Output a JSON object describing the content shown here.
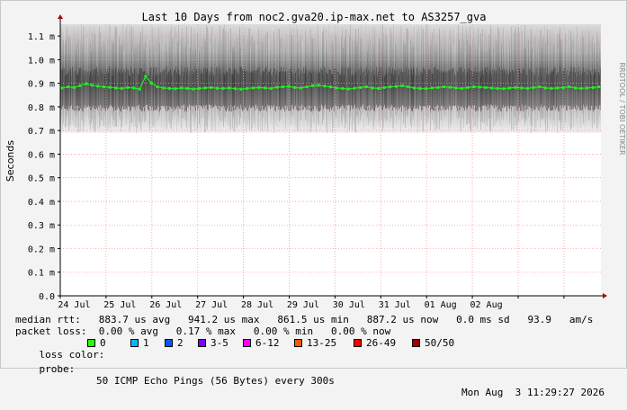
{
  "chart_data": {
    "type": "line",
    "title": "Last 10 Days from noc2.gva20.ip-max.net to AS3257_gva",
    "ylabel": "Seconds",
    "xlabel": "",
    "ylim": [
      0,
      1.15
    ],
    "y_ticks": [
      {
        "v": 0,
        "label": "0.0"
      },
      {
        "v": 0.1,
        "label": "0.1 m"
      },
      {
        "v": 0.2,
        "label": "0.2 m"
      },
      {
        "v": 0.3,
        "label": "0.3 m"
      },
      {
        "v": 0.4,
        "label": "0.4 m"
      },
      {
        "v": 0.5,
        "label": "0.5 m"
      },
      {
        "v": 0.6,
        "label": "0.6 m"
      },
      {
        "v": 0.7,
        "label": "0.7 m"
      },
      {
        "v": 0.8,
        "label": "0.8 m"
      },
      {
        "v": 0.9,
        "label": "0.9 m"
      },
      {
        "v": 1.0,
        "label": "1.0 m"
      },
      {
        "v": 1.1,
        "label": "1.1 m"
      }
    ],
    "x_ticks": [
      "24 Jul",
      "25 Jul",
      "26 Jul",
      "27 Jul",
      "28 Jul",
      "29 Jul",
      "30 Jul",
      "31 Jul",
      "01 Aug",
      "02 Aug"
    ],
    "grid": true,
    "series": [
      {
        "name": "median rtt",
        "color": "#22ee22",
        "values": [
          0.88,
          0.885,
          0.882,
          0.89,
          0.898,
          0.892,
          0.888,
          0.885,
          0.883,
          0.88,
          0.878,
          0.882,
          0.88,
          0.875,
          0.93,
          0.9,
          0.885,
          0.88,
          0.878,
          0.877,
          0.88,
          0.878,
          0.876,
          0.878,
          0.88,
          0.882,
          0.879,
          0.878,
          0.88,
          0.877,
          0.875,
          0.878,
          0.88,
          0.882,
          0.88,
          0.878,
          0.883,
          0.885,
          0.887,
          0.882,
          0.88,
          0.885,
          0.89,
          0.892,
          0.888,
          0.885,
          0.88,
          0.878,
          0.876,
          0.879,
          0.882,
          0.885,
          0.88,
          0.878,
          0.882,
          0.885,
          0.887,
          0.89,
          0.885,
          0.88,
          0.878,
          0.877,
          0.88,
          0.882,
          0.885,
          0.883,
          0.88,
          0.878,
          0.882,
          0.885,
          0.884,
          0.882,
          0.88,
          0.878,
          0.877,
          0.88,
          0.882,
          0.88,
          0.878,
          0.882,
          0.885,
          0.88,
          0.878,
          0.88,
          0.882,
          0.885,
          0.88,
          0.878,
          0.88,
          0.882,
          0.885
        ]
      }
    ],
    "smoke_band": {
      "min": 0.69,
      "max": 1.15,
      "dense_min": 0.78,
      "dense_max": 0.97
    }
  },
  "side_label": "RRDTOOL / TOBI OETIKER",
  "stats": {
    "median_rtt": "median rtt:   883.7 us avg   941.2 us max   861.5 us min   887.2 us now   0.0 ms sd   93.9   am/s",
    "packet_loss": "packet loss:  0.00 % avg   0.17 % max   0.00 % min   0.00 % now"
  },
  "legend": {
    "label": "loss color:",
    "items": [
      {
        "label": "0",
        "color": "#26ff00"
      },
      {
        "label": "1",
        "color": "#00b8ff"
      },
      {
        "label": "2",
        "color": "#0059ff"
      },
      {
        "label": "3-5",
        "color": "#7e00ff"
      },
      {
        "label": "6-12",
        "color": "#ff00ff"
      },
      {
        "label": "13-25",
        "color": "#ff5500"
      },
      {
        "label": "26-49",
        "color": "#ff0000"
      },
      {
        "label": "50/50",
        "color": "#a10000"
      }
    ]
  },
  "probe": {
    "label": "probe:",
    "text": "50 ICMP Echo Pings (56 Bytes) every 300s",
    "timestamp": "Mon Aug  3 11:29:27 2026"
  }
}
